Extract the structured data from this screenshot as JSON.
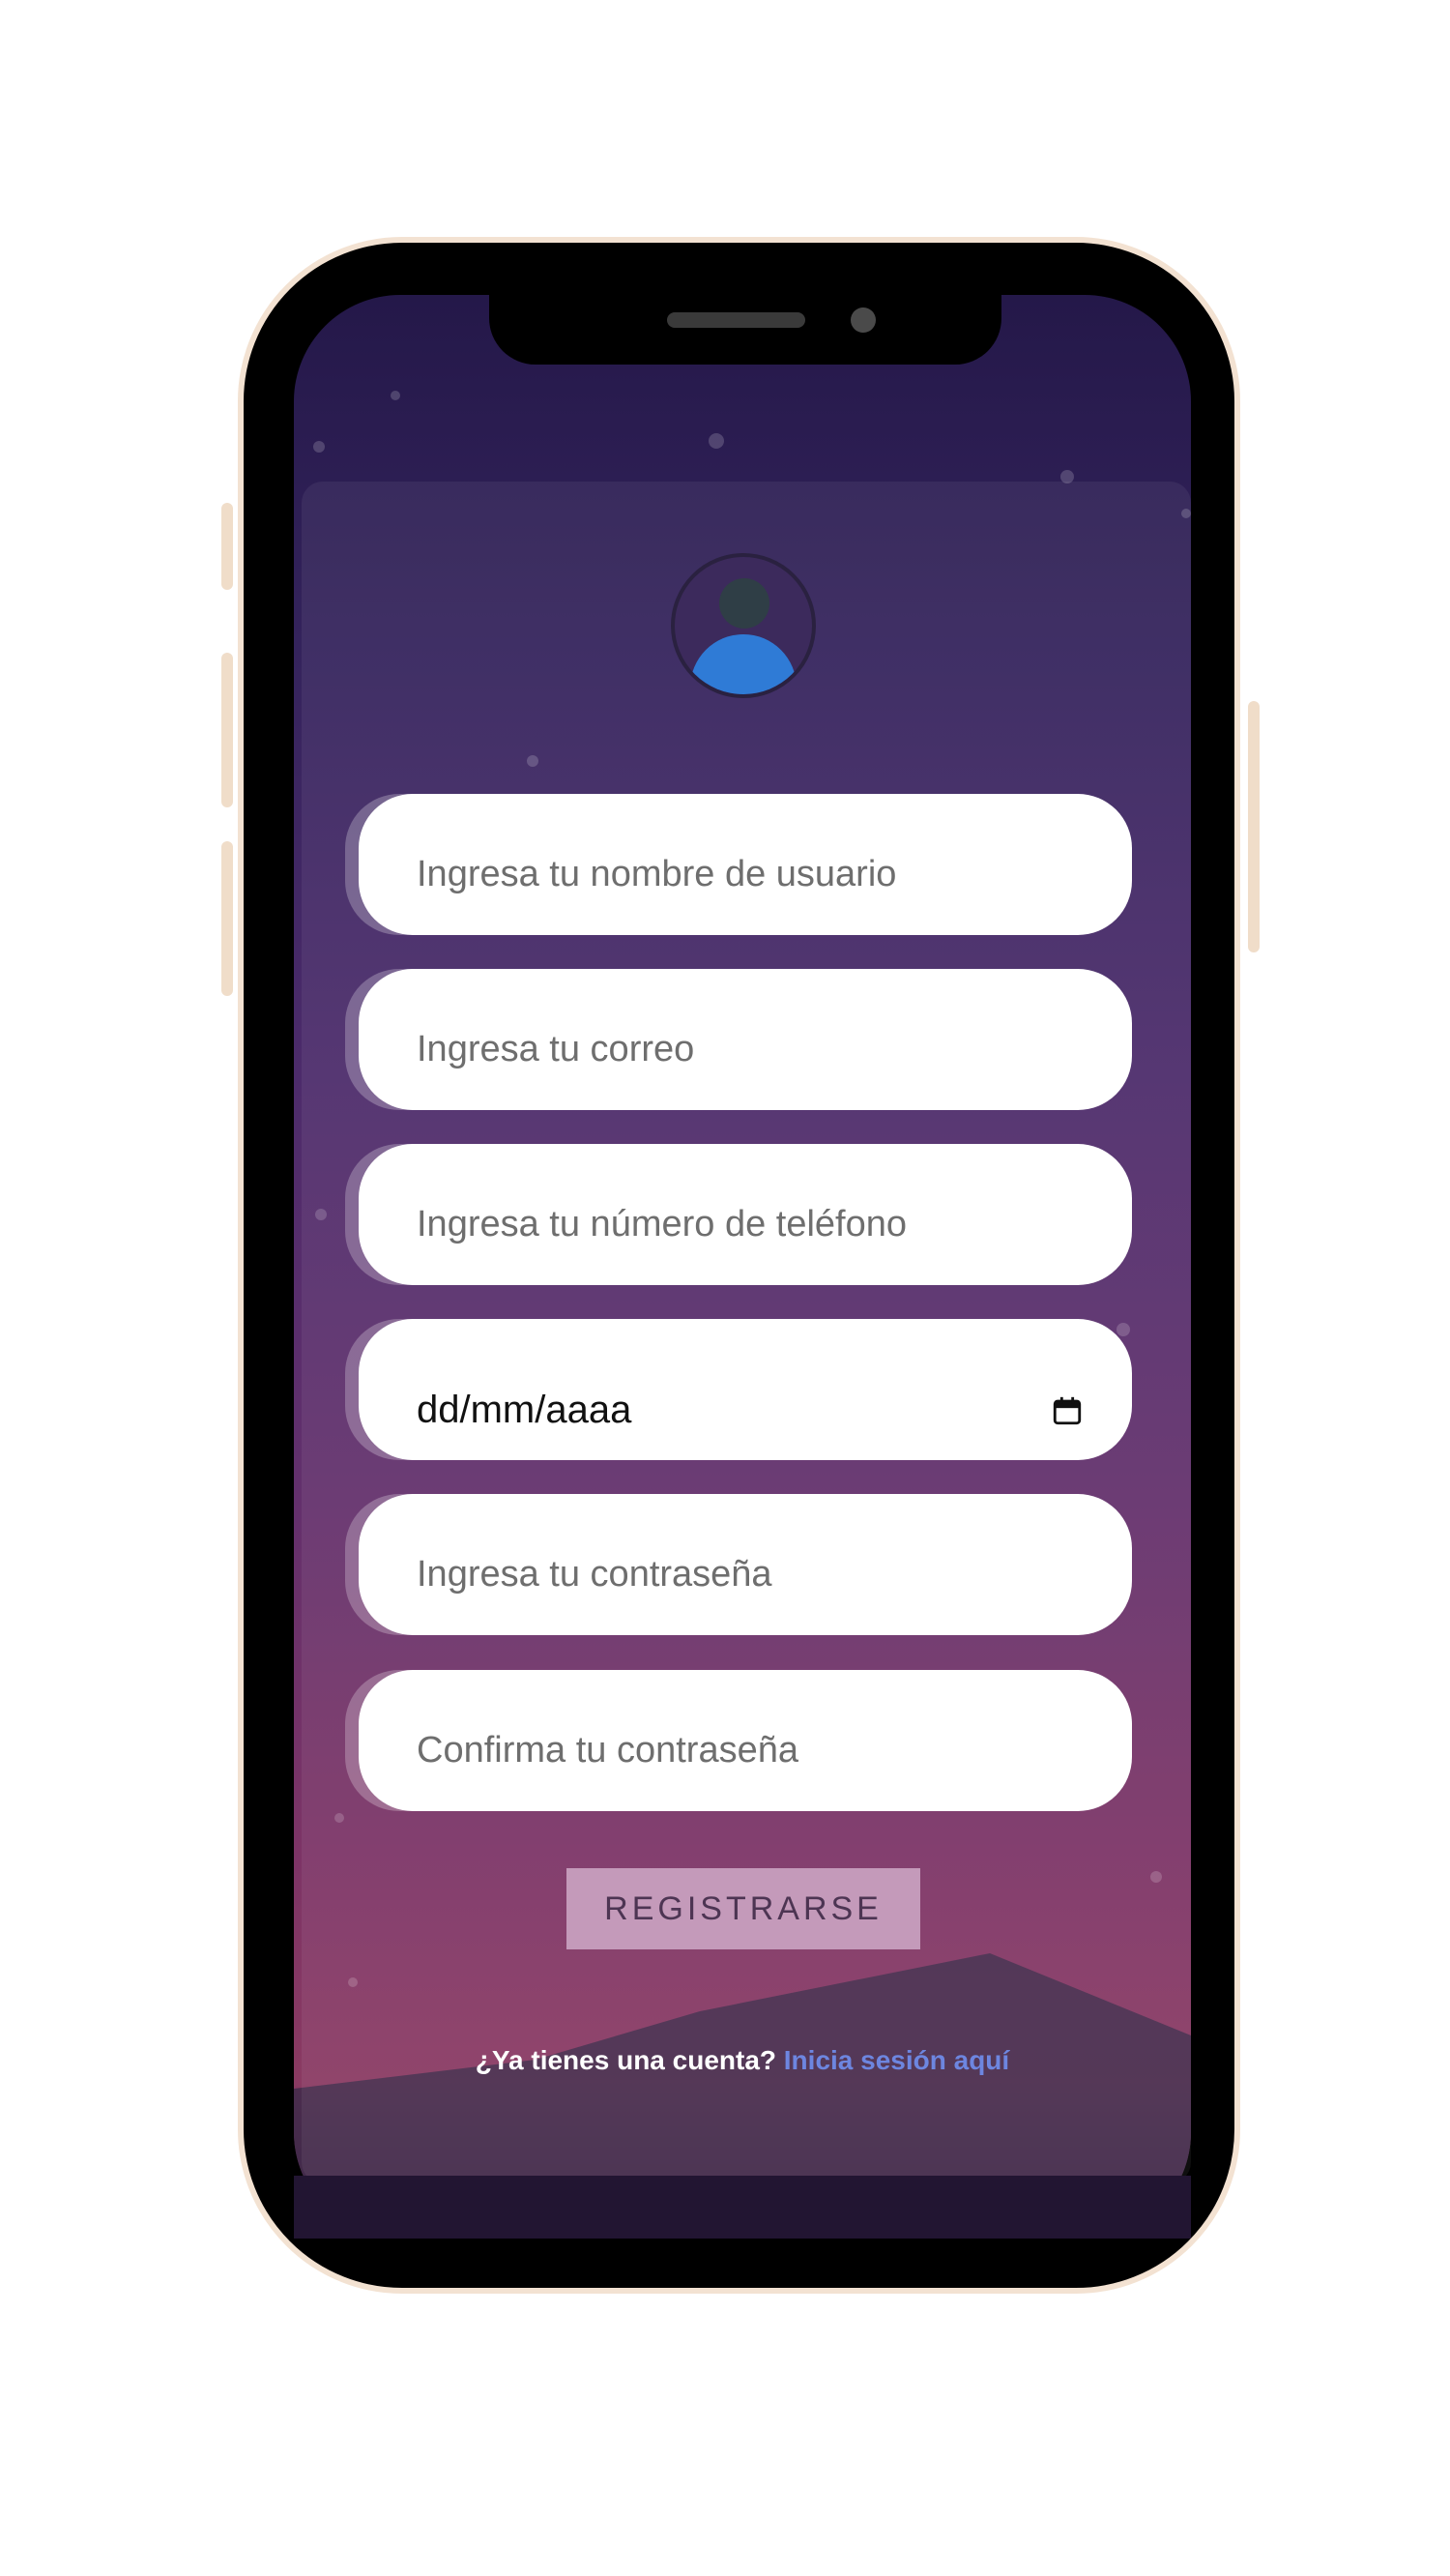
{
  "form": {
    "username_placeholder": "Ingresa tu nombre de usuario",
    "email_placeholder": "Ingresa tu correo",
    "phone_placeholder": "Ingresa tu número de teléfono",
    "date_placeholder": "dd/mm/aaaa",
    "password_placeholder": "Ingresa tu contraseña",
    "confirm_password_placeholder": "Confirma tu contraseña",
    "submit_label": "REGISTRARSE"
  },
  "footer": {
    "question": "¿Ya tienes una cuenta? ",
    "login_link": "Inicia sesión aquí"
  },
  "icons": {
    "avatar": "user-avatar-icon",
    "calendar": "calendar-icon"
  },
  "colors": {
    "background_top": "#241849",
    "background_bottom": "#8a3a62",
    "button": "#c49aba",
    "link": "#6d86e0",
    "avatar_body": "#2f7bd6"
  }
}
